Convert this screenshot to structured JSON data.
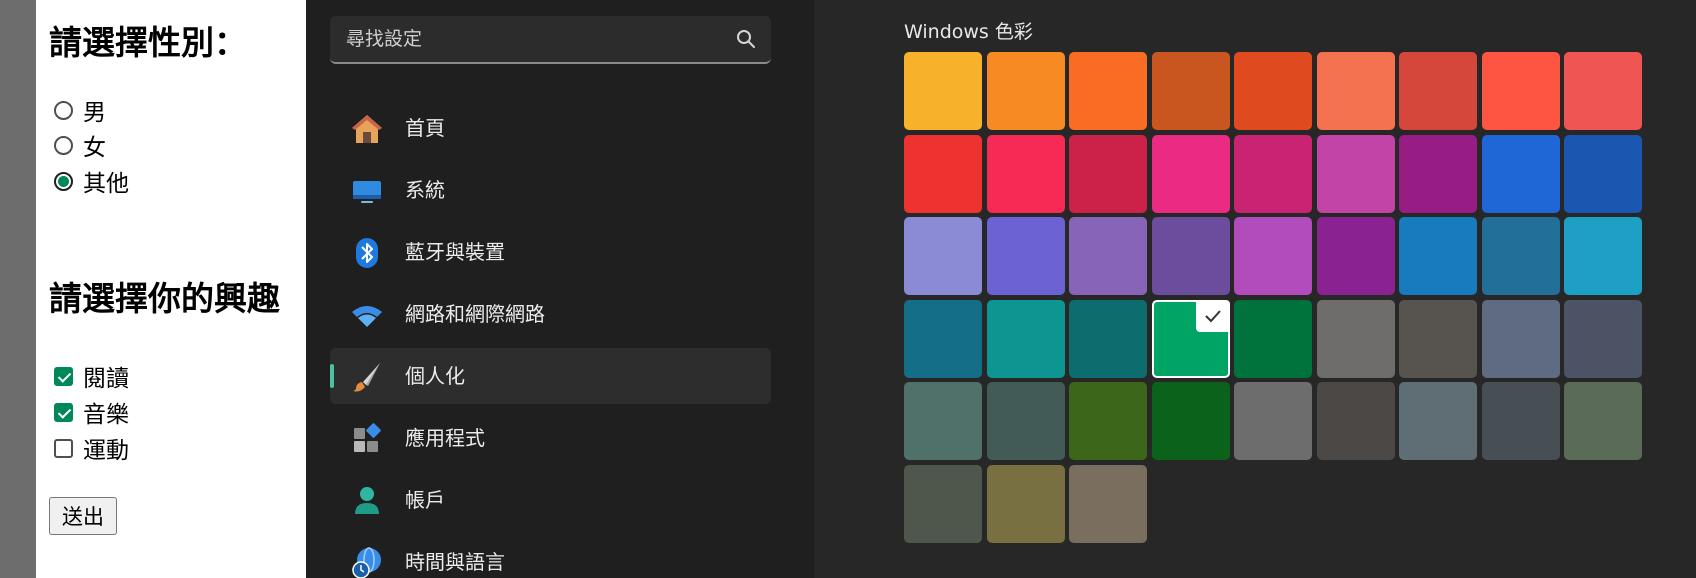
{
  "form": {
    "gender_heading": "請選擇性別：",
    "gender_options": [
      {
        "label": "男",
        "checked": false
      },
      {
        "label": "女",
        "checked": false
      },
      {
        "label": "其他",
        "checked": true
      }
    ],
    "hobby_heading": "請選擇你的興趣",
    "hobby_options": [
      {
        "label": "閱讀",
        "checked": true
      },
      {
        "label": "音樂",
        "checked": true
      },
      {
        "label": "運動",
        "checked": false
      }
    ],
    "submit_label": "送出"
  },
  "sidebar": {
    "search_placeholder": "尋找設定",
    "search_icon": "search-icon",
    "items": [
      {
        "label": "首頁",
        "icon": "home-icon",
        "active": false
      },
      {
        "label": "系統",
        "icon": "display-icon",
        "active": false
      },
      {
        "label": "藍牙與裝置",
        "icon": "bluetooth-icon",
        "active": false
      },
      {
        "label": "網路和網際網路",
        "icon": "wifi-icon",
        "active": false
      },
      {
        "label": "個人化",
        "icon": "brush-icon",
        "active": true
      },
      {
        "label": "應用程式",
        "icon": "apps-icon",
        "active": false
      },
      {
        "label": "帳戶",
        "icon": "person-icon",
        "active": false
      },
      {
        "label": "時間與語言",
        "icon": "globe-clock-icon",
        "active": false
      }
    ]
  },
  "colors": {
    "title": "Windows 色彩",
    "accent_indicator": "#4cc2a1",
    "selected_index": 30,
    "swatches": [
      "#f8b12a",
      "#f78a22",
      "#f86c23",
      "#c9561f",
      "#e04a1f",
      "#f47250",
      "#d5473b",
      "#fc5542",
      "#ef5552",
      "#ee3230",
      "#f72a55",
      "#cc2148",
      "#ea2a83",
      "#c92474",
      "#c244a6",
      "#971d84",
      "#1f66d6",
      "#1b56b1",
      "#8b8ad5",
      "#6b63d4",
      "#8864b8",
      "#6b4c9d",
      "#b24cbc",
      "#8a2391",
      "#177bbd",
      "#22709a",
      "#1da0c3",
      "#146e87",
      "#0d9691",
      "#0d6c6d",
      "#00a464",
      "#00723b",
      "#6f6d6b",
      "#575450",
      "#5f6b82",
      "#4c5365",
      "#4f7169",
      "#425b57",
      "#3c6619",
      "#0b631b",
      "#6d6d6d",
      "#4b4845",
      "#5f6e75",
      "#474e54",
      "#5a6b58",
      "#4f574d",
      "#787041",
      "#7a6e5e"
    ]
  }
}
